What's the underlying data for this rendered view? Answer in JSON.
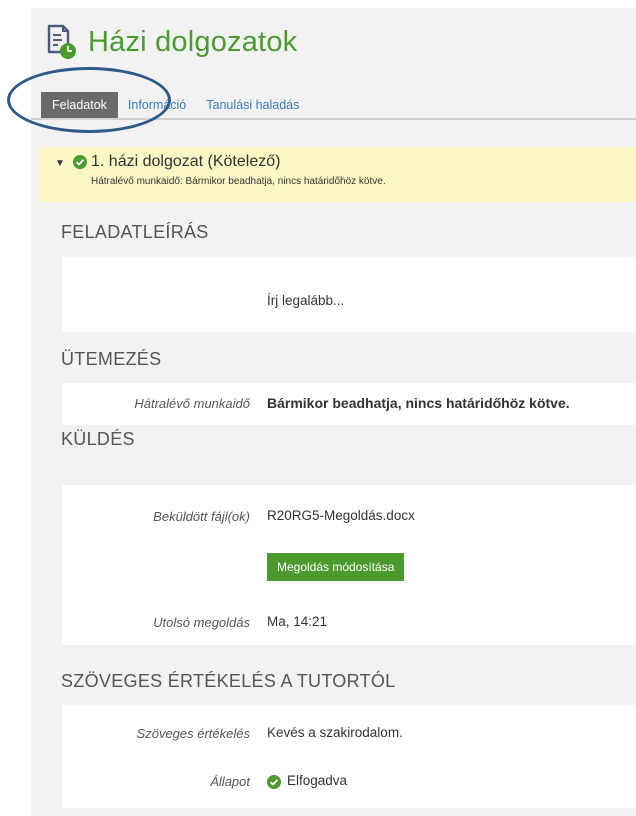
{
  "app": {
    "title": "Házi dolgozatok"
  },
  "tabs": [
    {
      "label": "Feladatok",
      "active": true
    },
    {
      "label": "Információ",
      "active": false
    },
    {
      "label": "Tanulási haladás",
      "active": false
    }
  ],
  "assignment": {
    "title": "1. házi dolgozat (Kötelező)",
    "remaining_line": "Hátralévő munkaidő: Bármikor beadhatja, nincs határidőhöz kötve."
  },
  "sections": {
    "description": {
      "title": "FELADATLEÍRÁS",
      "text": "Írj legalább..."
    },
    "schedule": {
      "title": "ÜTEMEZÉS",
      "label": "Hátralévő munkaidő",
      "value": "Bármikor beadhatja, nincs határidőhöz kötve."
    },
    "submission": {
      "title": "KÜLDÉS",
      "files_label": "Beküldött fájl(ok)",
      "file_name": "R20RG5-Megoldás.docx",
      "modify_button": "Megoldás módosítása",
      "last_label": "Utolsó megoldás",
      "last_value": "Ma, 14:21"
    },
    "feedback": {
      "title": "SZÖVEGES ÉRTÉKELÉS A TUTORTÓL",
      "eval_label": "Szöveges értékelés",
      "eval_value": "Kevés a szakirodalom.",
      "status_label": "Állapot",
      "status_value": "Elfogadva"
    }
  },
  "colors": {
    "brand_green": "#4a9a2e",
    "tab_active_bg": "#6a6a6a",
    "link_blue": "#3b7bb4",
    "highlight_yellow": "#fbf8c6",
    "annotation_circle": "#2e5a86"
  },
  "icons": {
    "app": "document-clock-icon",
    "status": "check-circle-icon",
    "toggle": "triangle-down-icon"
  }
}
